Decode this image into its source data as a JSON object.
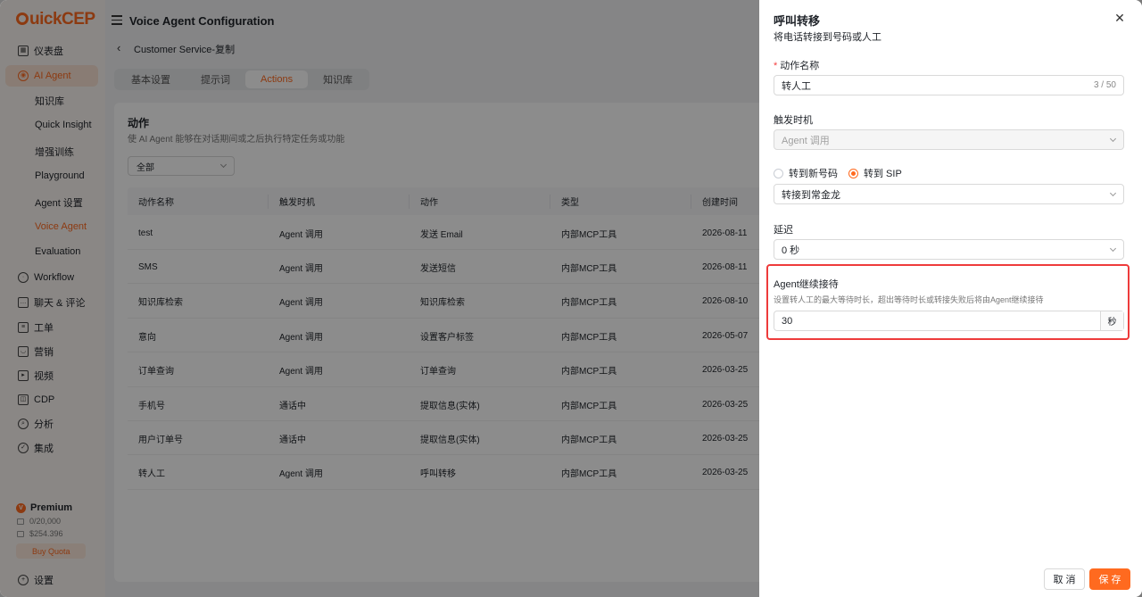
{
  "app": {
    "logo": "uickCEP",
    "page_title": "Voice Agent Configuration",
    "breadcrumb": "Customer Service-复制"
  },
  "sidebar": {
    "items": [
      {
        "label": "仪表盘",
        "icon": "dashboard-icon"
      },
      {
        "label": "AI Agent",
        "icon": "ai-agent-icon",
        "active": true
      },
      {
        "label": "Workflow",
        "icon": "workflow-icon"
      },
      {
        "label": "聊天 & 评论",
        "icon": "chat-icon"
      },
      {
        "label": "工单",
        "icon": "ticket-icon"
      },
      {
        "label": "营销",
        "icon": "marketing-icon"
      },
      {
        "label": "视频",
        "icon": "video-icon"
      },
      {
        "label": "CDP",
        "icon": "cdp-icon"
      },
      {
        "label": "分析",
        "icon": "analytics-icon"
      },
      {
        "label": "集成",
        "icon": "integration-icon"
      }
    ],
    "subitems": [
      "知识库",
      "Quick Insight",
      "增强训练",
      "Playground",
      "Agent 设置",
      "Voice Agent",
      "Evaluation"
    ],
    "active_subitem": "Voice Agent",
    "plan": "Premium",
    "quota_1": "0/20,000",
    "quota_2": "$254.396",
    "buy_quota": "Buy Quota",
    "settings": "设置"
  },
  "tabs": [
    "基本设置",
    "提示词",
    "Actions",
    "知识库"
  ],
  "active_tab": "Actions",
  "actions_section": {
    "title": "动作",
    "description": "使 AI Agent 能够在对话期间或之后执行特定任务或功能",
    "filter": "全部",
    "columns": [
      "动作名称",
      "触发时机",
      "动作",
      "类型",
      "创建时间"
    ],
    "rows": [
      [
        "test",
        "Agent 调用",
        "发送 Email",
        "内部MCP工具",
        "2026-08-11"
      ],
      [
        "SMS",
        "Agent 调用",
        "发送短信",
        "内部MCP工具",
        "2026-08-11"
      ],
      [
        "知识库检索",
        "Agent 调用",
        "知识库检索",
        "内部MCP工具",
        "2026-08-10"
      ],
      [
        "意向",
        "Agent 调用",
        "设置客户标签",
        "内部MCP工具",
        "2026-05-07"
      ],
      [
        "订单查询",
        "Agent 调用",
        "订单查询",
        "内部MCP工具",
        "2026-03-25"
      ],
      [
        "手机号",
        "通话中",
        "提取信息(实体)",
        "内部MCP工具",
        "2026-03-25"
      ],
      [
        "用户订单号",
        "通话中",
        "提取信息(实体)",
        "内部MCP工具",
        "2026-03-25"
      ],
      [
        "转人工",
        "Agent 调用",
        "呼叫转移",
        "内部MCP工具",
        "2026-03-25"
      ]
    ]
  },
  "drawer": {
    "title": "呼叫转移",
    "subtitle": "将电话转接到号码或人工",
    "name_label": "动作名称",
    "name_value": "转人工",
    "name_count": "3 / 50",
    "trigger_label": "触发时机",
    "trigger_value": "Agent 调用",
    "radio_new_number": "转到新号码",
    "radio_sip": "转到 SIP",
    "selected_radio": "sip",
    "sip_target": "转接到常金龙",
    "delay_label": "延迟",
    "delay_value": "0 秒",
    "agent_title": "Agent继续接待",
    "agent_desc": "设置转人工的最大等待时长，超出等待时长或转接失败后将由Agent继续接待",
    "wait_value": "30",
    "wait_unit": "秒",
    "cancel": "取 消",
    "save": "保 存"
  },
  "colors": {
    "accent": "#ff6a1f",
    "highlight_border": "#ee3b3b"
  }
}
